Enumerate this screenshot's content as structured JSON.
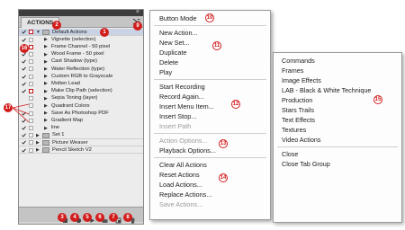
{
  "panel": {
    "tab_label": "ACTIONS",
    "close_glyph": "×",
    "rows": [
      {
        "label": "Default Actions",
        "kind": "set",
        "open": true
      },
      {
        "label": "Vignette (selection)",
        "kind": "action"
      },
      {
        "label": "Frame Channel - 50 pixel",
        "kind": "action"
      },
      {
        "label": "Wood Frame - 50 pixel",
        "kind": "action"
      },
      {
        "label": "Cast Shadow (type)",
        "kind": "action"
      },
      {
        "label": "Water Reflection (type)",
        "kind": "action"
      },
      {
        "label": "Custom RGB to Grayscale",
        "kind": "action"
      },
      {
        "label": "Molten Lead",
        "kind": "action"
      },
      {
        "label": "Make Clip Path (selection)",
        "kind": "action"
      },
      {
        "label": "Sepia Toning (layer)",
        "kind": "action"
      },
      {
        "label": "Quadrant Colors",
        "kind": "action"
      },
      {
        "label": "Save As Photoshop PDF",
        "kind": "action"
      },
      {
        "label": "Gradient Map",
        "kind": "action"
      },
      {
        "label": "line",
        "kind": "action"
      },
      {
        "label": "Set 1",
        "kind": "set",
        "open": false
      },
      {
        "label": "Picture Weaver",
        "kind": "set",
        "open": false
      },
      {
        "label": "Pencil Sketch V2",
        "kind": "set",
        "open": false
      }
    ]
  },
  "annotations": {
    "b1": "1",
    "b2": "2",
    "b3": "3",
    "b4": "4",
    "b5": "5",
    "b6": "6",
    "b7": "7",
    "b8": "8",
    "b9": "9",
    "b10": "10",
    "b11": "11",
    "b12": "12",
    "b13": "13",
    "b14": "14",
    "b15": "15",
    "b16": "16",
    "b17": "17"
  },
  "menu": {
    "button_mode": "Button Mode",
    "new_action": "New Action...",
    "new_set": "New Set...",
    "duplicate": "Duplicate",
    "delete": "Delete",
    "play": "Play",
    "start_recording": "Start Recording",
    "record_again": "Record Again...",
    "insert_menu_item": "Insert Menu Item...",
    "insert_stop": "Insert Stop...",
    "insert_path": "Insert Path",
    "action_options": "Action Options...",
    "playback_options": "Playback Options...",
    "clear_all_actions": "Clear All Actions",
    "reset_actions": "Reset Actions",
    "load_actions": "Load Actions...",
    "replace_actions": "Replace Actions...",
    "save_actions": "Save Actions..."
  },
  "submenu": {
    "commands": "Commands",
    "frames": "Frames",
    "image_effects": "Image Effects",
    "lab_bw": "LAB - Black & White Technique",
    "production": "Production",
    "stars_trails": "Stars Trails",
    "text_effects": "Text Effects",
    "textures": "Textures",
    "video_actions": "Video Actions",
    "close": "Close",
    "close_tab_group": "Close Tab Group"
  },
  "colors": {
    "annotation_red": "#d21d1d",
    "panel_gray": "#d6d6d6",
    "selected_row": "#c9d3e3"
  }
}
